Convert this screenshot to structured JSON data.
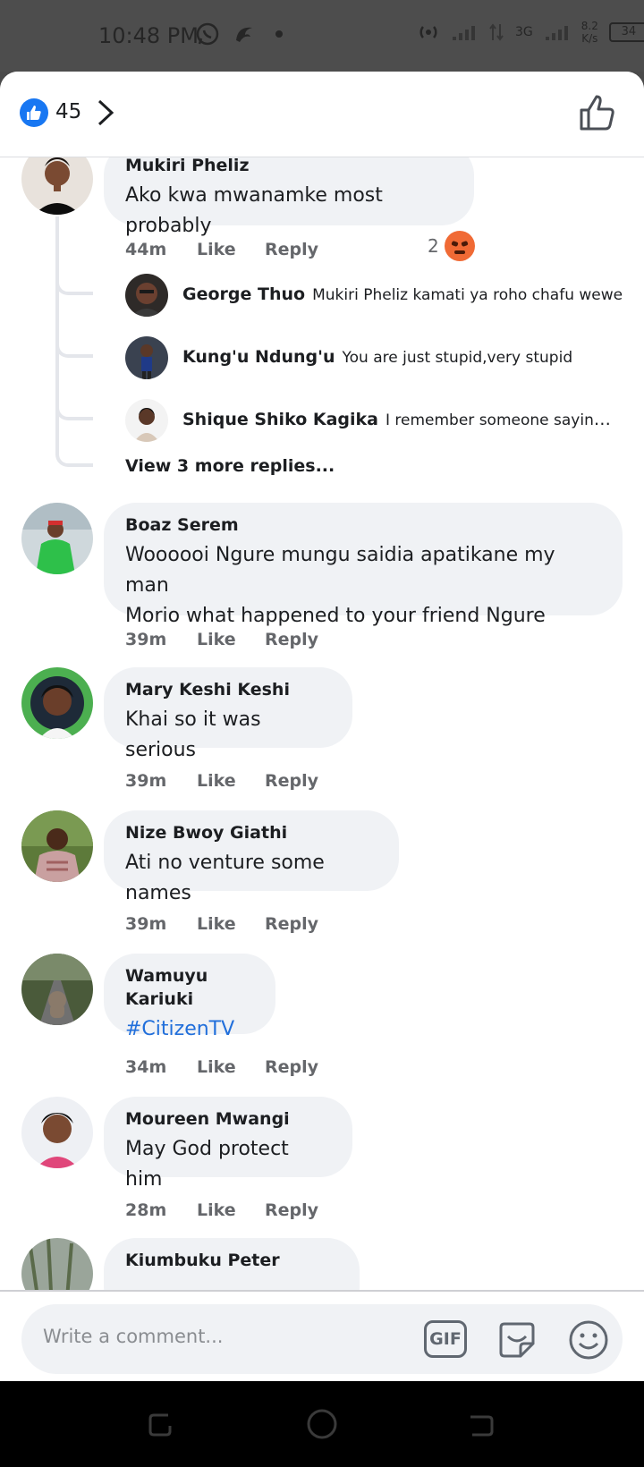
{
  "status_bar": {
    "time": "10:48 PM",
    "network": "3G",
    "net_speed_value": "8.2",
    "net_speed_unit": "K/s",
    "battery": "34"
  },
  "header": {
    "like_count": "45"
  },
  "comments": [
    {
      "name": "Mukiri Pheliz",
      "text": "Ako kwa mwanamke most probably",
      "time": "44m",
      "like": "Like",
      "reply": "Reply",
      "reaction_count": "2"
    },
    {
      "name": "Boaz Serem",
      "text_line1": "Woooooi Ngure mungu saidia apatikane my man",
      "text_line2": "Morio what happened to your friend Ngure",
      "time": "39m",
      "like": "Like",
      "reply": "Reply"
    },
    {
      "name": "Mary Keshi Keshi",
      "text": "Khai so it was serious",
      "time": "39m",
      "like": "Like",
      "reply": "Reply"
    },
    {
      "name": "Nize Bwoy Giathi",
      "text": "Ati no venture some names",
      "time": "39m",
      "like": "Like",
      "reply": "Reply"
    },
    {
      "name": "Wamuyu Kariuki",
      "text": "#CitizenTV",
      "time": "34m",
      "like": "Like",
      "reply": "Reply"
    },
    {
      "name": "Moureen Mwangi",
      "text": "May God protect him",
      "time": "28m",
      "like": "Like",
      "reply": "Reply"
    },
    {
      "name": "Kiumbuku Peter"
    }
  ],
  "replies": [
    {
      "name": "George Thuo",
      "text": "Mukiri Pheliz kamati ya roho chafu wewe"
    },
    {
      "name": "Kung'u Ndung'u",
      "text": "You are just stupid,very stupid"
    },
    {
      "name": "Shique Shiko Kagika",
      "text": "I remember someone saying the sa..."
    }
  ],
  "view_more_replies": "View 3 more replies...",
  "composer": {
    "placeholder": "Write a comment...",
    "gif_label": "GIF"
  },
  "colors": {
    "accent": "#1877f2",
    "link": "#216fdb",
    "bubble": "#f0f2f5",
    "secondary_text": "#65676b"
  }
}
